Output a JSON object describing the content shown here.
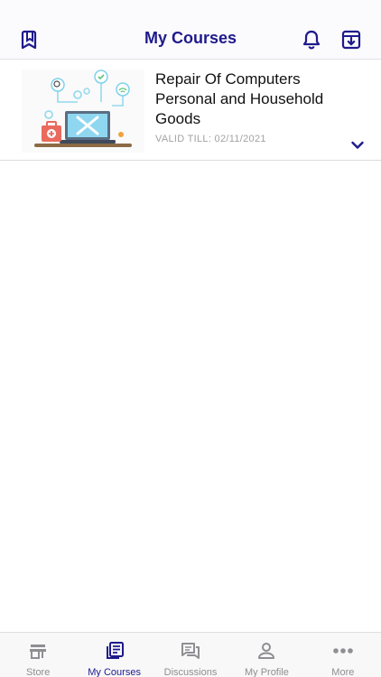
{
  "header": {
    "title": "My Courses"
  },
  "courses": [
    {
      "title": "Repair Of Computers Personal and Household Goods",
      "valid_till": "VALID TILL: 02/11/2021"
    }
  ],
  "tabs": [
    {
      "label": "Store",
      "icon": "store-icon"
    },
    {
      "label": "My Courses",
      "icon": "courses-icon"
    },
    {
      "label": "Discussions",
      "icon": "discussions-icon"
    },
    {
      "label": "My Profile",
      "icon": "profile-icon"
    },
    {
      "label": "More",
      "icon": "more-icon"
    }
  ],
  "colors": {
    "accent": "#1e1a8c",
    "inactive": "#8e8e93"
  }
}
